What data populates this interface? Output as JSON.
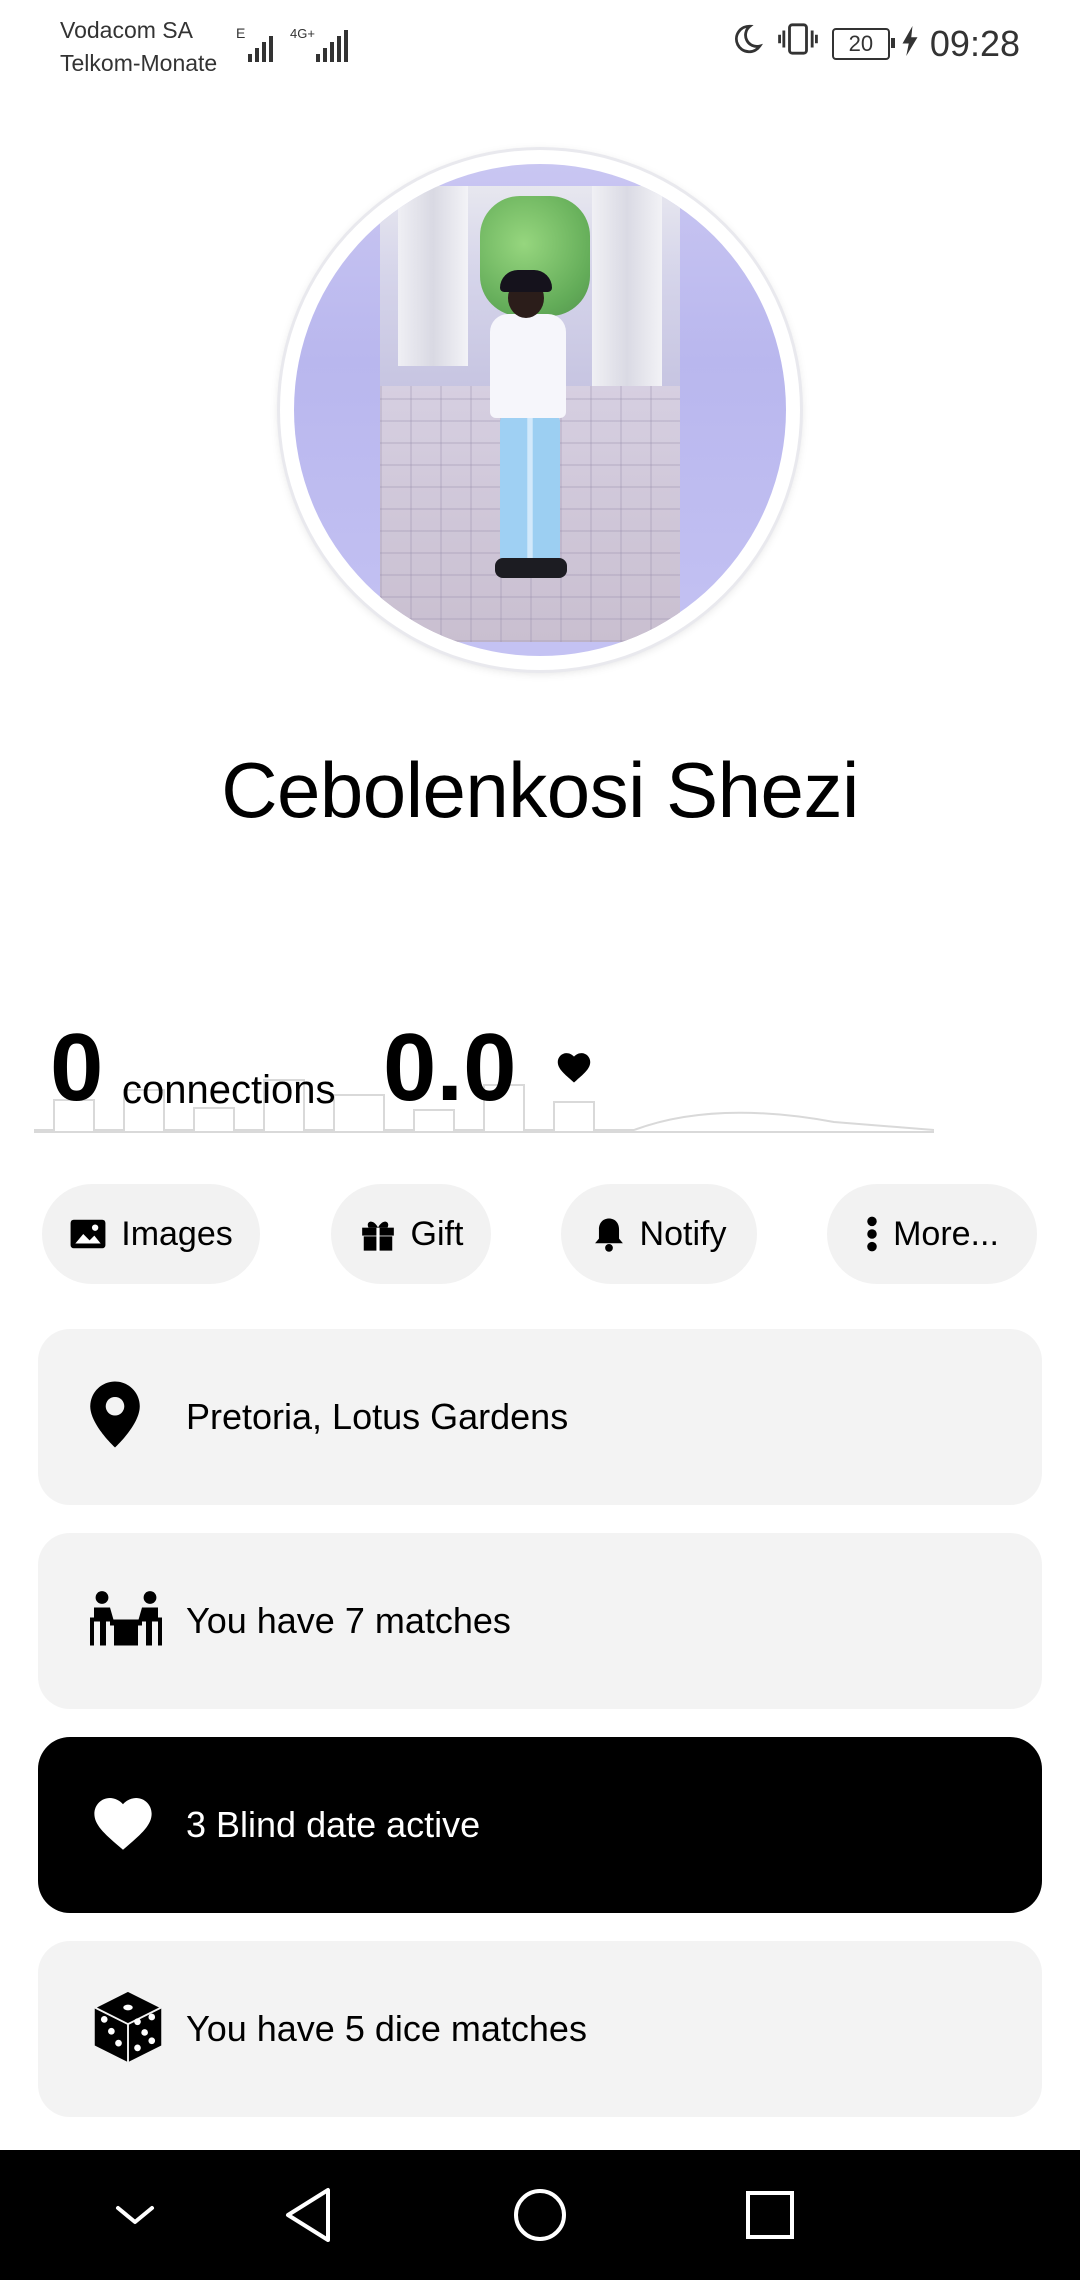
{
  "status_bar": {
    "carrier_1": "Vodacom SA",
    "carrier_2": "Telkom-Monate",
    "network_1": "E",
    "network_2": "4G+",
    "battery": "20",
    "time": "09:28"
  },
  "profile": {
    "name": "Cebolenkosi Shezi"
  },
  "stats": {
    "connections_count": "0",
    "connections_label": "connections",
    "rating": "0.0"
  },
  "actions": [
    {
      "label": "Images",
      "icon": "image-icon"
    },
    {
      "label": "Gift",
      "icon": "gift-icon"
    },
    {
      "label": "Notify",
      "icon": "bell-icon"
    },
    {
      "label": "More...",
      "icon": "more-vertical-icon"
    }
  ],
  "cards": [
    {
      "text": "Pretoria, Lotus Gardens",
      "icon": "location-pin-icon"
    },
    {
      "text": "You have 7 matches",
      "icon": "couple-table-icon"
    },
    {
      "text": "3 Blind date active",
      "icon": "heart-icon"
    },
    {
      "text": "You have 5 dice matches",
      "icon": "dice-icon"
    }
  ],
  "colors": {
    "background": "#ffffff",
    "card": "#f3f3f3",
    "chip": "#f2f2f2",
    "active_card": "#000000",
    "nav_bar": "#000000"
  }
}
